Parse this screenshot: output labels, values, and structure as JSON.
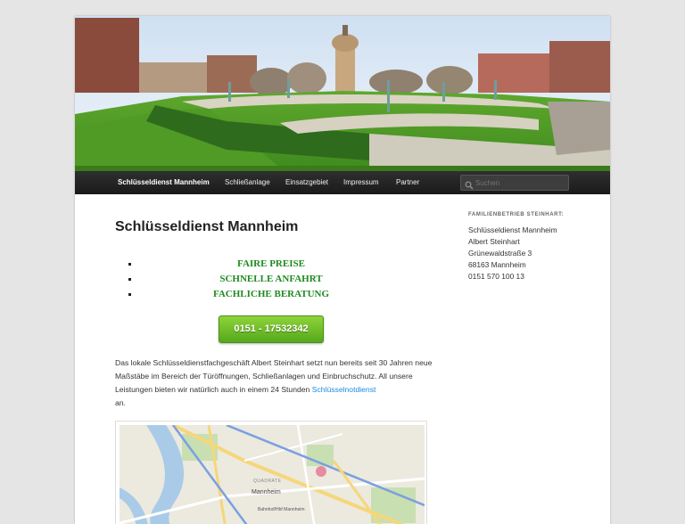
{
  "nav": {
    "items": [
      {
        "label": "Schlüsseldienst Mannheim",
        "active": true
      },
      {
        "label": "Schließanlage",
        "active": false
      },
      {
        "label": "Einsatzgebiet",
        "active": false
      },
      {
        "label": "Impressum",
        "active": false
      },
      {
        "label": "Partner",
        "active": false
      }
    ],
    "search_placeholder": "Suchen"
  },
  "main": {
    "title": "Schlüsseldienst Mannheim",
    "features": [
      "FAIRE PREISE",
      "SCHNELLE ANFAHRT",
      "FACHLICHE BERATUNG"
    ],
    "call_button": "0151 - 17532342",
    "intro_text": "Das lokale Schlüsseldienstfachgeschäft Albert Steinhart setzt nun bereits seit 30 Jahren neue Maßstäbe im Bereich der Türöffnungen, Schließanlagen und Einbruchschutz. All unsere Leistungen bieten wir natürlich auch in einem 24 Stunden",
    "intro_link": "Schlüsselnotdienst",
    "intro_tail": "an.",
    "map_labels": {
      "city": "Mannheim",
      "district": "QUADRATE",
      "station": "Bahnhof/Hbf Mannheim"
    }
  },
  "sidebar": {
    "widget_title": "FAMILIENBETRIEB STEINHART:",
    "address": [
      "Schlüsseldienst Mannheim",
      "Albert Steinhart",
      "Grünewaldstraße 3",
      "68163 Mannheim",
      "0151 570 100 13"
    ]
  },
  "colors": {
    "accent_green": "#1f8a1f",
    "link_blue": "#1b8be0",
    "button_green": "#6dbb28",
    "nav_bg": "#222222"
  }
}
